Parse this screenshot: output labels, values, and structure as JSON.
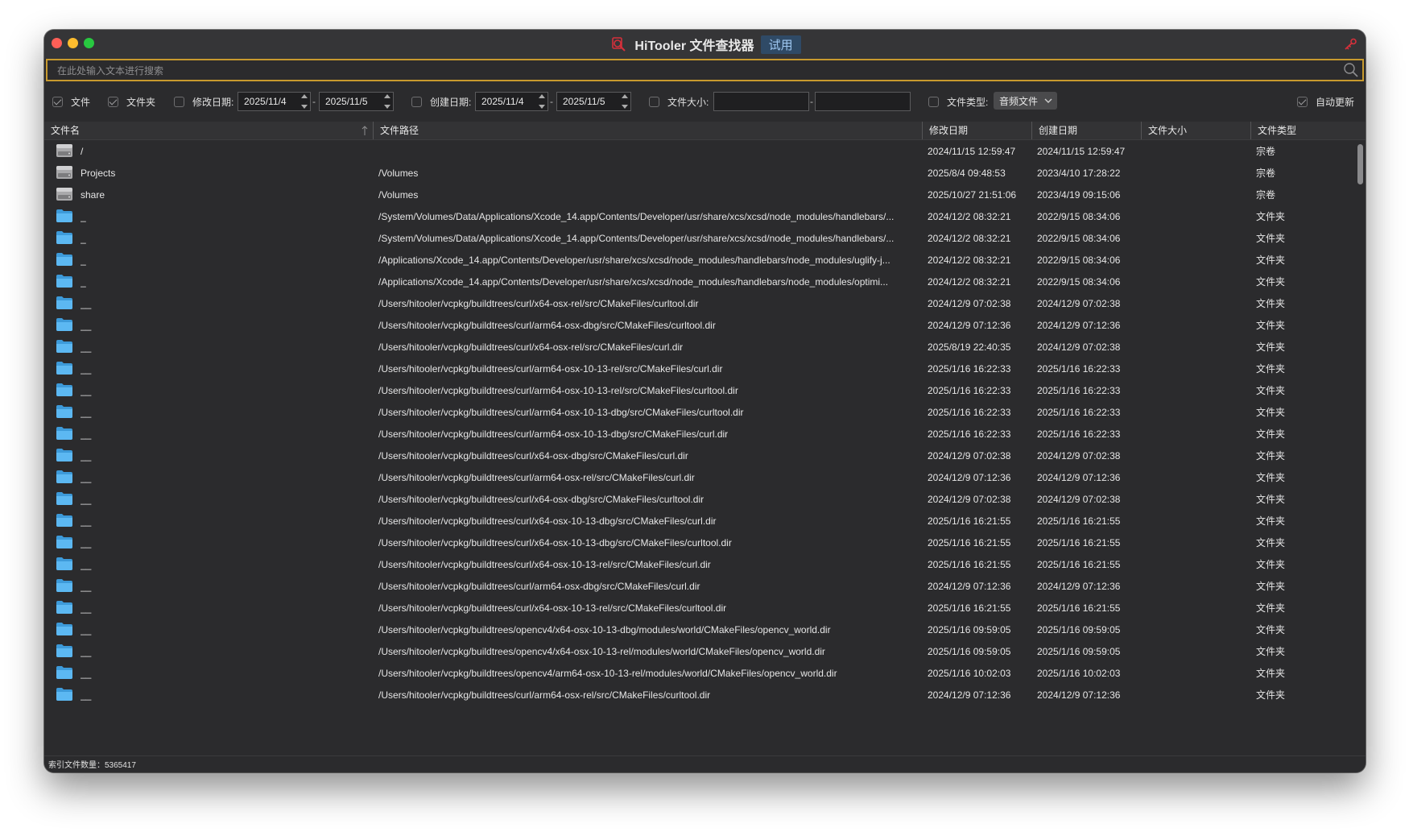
{
  "window": {
    "title": "HiTooler 文件查找器",
    "badge": "试用",
    "accent_color": "#c89a2e"
  },
  "search": {
    "placeholder": "在此处输入文本进行搜索",
    "value": ""
  },
  "filters": {
    "file": {
      "label": "文件",
      "checked": true
    },
    "folder": {
      "label": "文件夹",
      "checked": true
    },
    "modified": {
      "label": "修改日期:",
      "checked": false,
      "from": "2025/11/4",
      "to": "2025/11/5",
      "separator": "-"
    },
    "created": {
      "label": "创建日期:",
      "checked": false,
      "from": "2025/11/4",
      "to": "2025/11/5",
      "separator": "-"
    },
    "size": {
      "label": "文件大小:",
      "checked": false,
      "min": "",
      "max": "",
      "separator": "-"
    },
    "type": {
      "label": "文件类型:",
      "checked": false,
      "selected": "音频文件"
    },
    "auto_update": {
      "label": "自动更新",
      "checked": true
    }
  },
  "columns": {
    "name": "文件名",
    "path": "文件路径",
    "modified": "修改日期",
    "created": "创建日期",
    "size": "文件大小",
    "type": "文件类型"
  },
  "rows": [
    {
      "icon": "drive-icon",
      "name": "/",
      "path": "",
      "modified": "2024/11/15 12:59:47",
      "created": "2024/11/15 12:59:47",
      "size": "",
      "type": "宗卷"
    },
    {
      "icon": "drive-icon",
      "name": "Projects",
      "path": "/Volumes",
      "modified": "2025/8/4 09:48:53",
      "created": "2023/4/10 17:28:22",
      "size": "",
      "type": "宗卷"
    },
    {
      "icon": "drive-icon",
      "name": "share",
      "path": "/Volumes",
      "modified": "2025/10/27 21:51:06",
      "created": "2023/4/19 09:15:06",
      "size": "",
      "type": "宗卷"
    },
    {
      "icon": "folder-icon",
      "name": "_",
      "path": "/System/Volumes/Data/Applications/Xcode_14.app/Contents/Developer/usr/share/xcs/xcsd/node_modules/handlebars/...",
      "modified": "2024/12/2 08:32:21",
      "created": "2022/9/15 08:34:06",
      "size": "",
      "type": "文件夹"
    },
    {
      "icon": "folder-icon",
      "name": "_",
      "path": "/System/Volumes/Data/Applications/Xcode_14.app/Contents/Developer/usr/share/xcs/xcsd/node_modules/handlebars/...",
      "modified": "2024/12/2 08:32:21",
      "created": "2022/9/15 08:34:06",
      "size": "",
      "type": "文件夹"
    },
    {
      "icon": "folder-icon",
      "name": "_",
      "path": "/Applications/Xcode_14.app/Contents/Developer/usr/share/xcs/xcsd/node_modules/handlebars/node_modules/uglify-j...",
      "modified": "2024/12/2 08:32:21",
      "created": "2022/9/15 08:34:06",
      "size": "",
      "type": "文件夹"
    },
    {
      "icon": "folder-icon",
      "name": "_",
      "path": "/Applications/Xcode_14.app/Contents/Developer/usr/share/xcs/xcsd/node_modules/handlebars/node_modules/optimi...",
      "modified": "2024/12/2 08:32:21",
      "created": "2022/9/15 08:34:06",
      "size": "",
      "type": "文件夹"
    },
    {
      "icon": "folder-icon",
      "name": "__",
      "path": "/Users/hitooler/vcpkg/buildtrees/curl/x64-osx-rel/src/CMakeFiles/curltool.dir",
      "modified": "2024/12/9 07:02:38",
      "created": "2024/12/9 07:02:38",
      "size": "",
      "type": "文件夹"
    },
    {
      "icon": "folder-icon",
      "name": "__",
      "path": "/Users/hitooler/vcpkg/buildtrees/curl/arm64-osx-dbg/src/CMakeFiles/curltool.dir",
      "modified": "2024/12/9 07:12:36",
      "created": "2024/12/9 07:12:36",
      "size": "",
      "type": "文件夹"
    },
    {
      "icon": "folder-icon",
      "name": "__",
      "path": "/Users/hitooler/vcpkg/buildtrees/curl/x64-osx-rel/src/CMakeFiles/curl.dir",
      "modified": "2025/8/19 22:40:35",
      "created": "2024/12/9 07:02:38",
      "size": "",
      "type": "文件夹"
    },
    {
      "icon": "folder-icon",
      "name": "__",
      "path": "/Users/hitooler/vcpkg/buildtrees/curl/arm64-osx-10-13-rel/src/CMakeFiles/curl.dir",
      "modified": "2025/1/16 16:22:33",
      "created": "2025/1/16 16:22:33",
      "size": "",
      "type": "文件夹"
    },
    {
      "icon": "folder-icon",
      "name": "__",
      "path": "/Users/hitooler/vcpkg/buildtrees/curl/arm64-osx-10-13-rel/src/CMakeFiles/curltool.dir",
      "modified": "2025/1/16 16:22:33",
      "created": "2025/1/16 16:22:33",
      "size": "",
      "type": "文件夹"
    },
    {
      "icon": "folder-icon",
      "name": "__",
      "path": "/Users/hitooler/vcpkg/buildtrees/curl/arm64-osx-10-13-dbg/src/CMakeFiles/curltool.dir",
      "modified": "2025/1/16 16:22:33",
      "created": "2025/1/16 16:22:33",
      "size": "",
      "type": "文件夹"
    },
    {
      "icon": "folder-icon",
      "name": "__",
      "path": "/Users/hitooler/vcpkg/buildtrees/curl/arm64-osx-10-13-dbg/src/CMakeFiles/curl.dir",
      "modified": "2025/1/16 16:22:33",
      "created": "2025/1/16 16:22:33",
      "size": "",
      "type": "文件夹"
    },
    {
      "icon": "folder-icon",
      "name": "__",
      "path": "/Users/hitooler/vcpkg/buildtrees/curl/x64-osx-dbg/src/CMakeFiles/curl.dir",
      "modified": "2024/12/9 07:02:38",
      "created": "2024/12/9 07:02:38",
      "size": "",
      "type": "文件夹"
    },
    {
      "icon": "folder-icon",
      "name": "__",
      "path": "/Users/hitooler/vcpkg/buildtrees/curl/arm64-osx-rel/src/CMakeFiles/curl.dir",
      "modified": "2024/12/9 07:12:36",
      "created": "2024/12/9 07:12:36",
      "size": "",
      "type": "文件夹"
    },
    {
      "icon": "folder-icon",
      "name": "__",
      "path": "/Users/hitooler/vcpkg/buildtrees/curl/x64-osx-dbg/src/CMakeFiles/curltool.dir",
      "modified": "2024/12/9 07:02:38",
      "created": "2024/12/9 07:02:38",
      "size": "",
      "type": "文件夹"
    },
    {
      "icon": "folder-icon",
      "name": "__",
      "path": "/Users/hitooler/vcpkg/buildtrees/curl/x64-osx-10-13-dbg/src/CMakeFiles/curl.dir",
      "modified": "2025/1/16 16:21:55",
      "created": "2025/1/16 16:21:55",
      "size": "",
      "type": "文件夹"
    },
    {
      "icon": "folder-icon",
      "name": "__",
      "path": "/Users/hitooler/vcpkg/buildtrees/curl/x64-osx-10-13-dbg/src/CMakeFiles/curltool.dir",
      "modified": "2025/1/16 16:21:55",
      "created": "2025/1/16 16:21:55",
      "size": "",
      "type": "文件夹"
    },
    {
      "icon": "folder-icon",
      "name": "__",
      "path": "/Users/hitooler/vcpkg/buildtrees/curl/x64-osx-10-13-rel/src/CMakeFiles/curl.dir",
      "modified": "2025/1/16 16:21:55",
      "created": "2025/1/16 16:21:55",
      "size": "",
      "type": "文件夹"
    },
    {
      "icon": "folder-icon",
      "name": "__",
      "path": "/Users/hitooler/vcpkg/buildtrees/curl/arm64-osx-dbg/src/CMakeFiles/curl.dir",
      "modified": "2024/12/9 07:12:36",
      "created": "2024/12/9 07:12:36",
      "size": "",
      "type": "文件夹"
    },
    {
      "icon": "folder-icon",
      "name": "__",
      "path": "/Users/hitooler/vcpkg/buildtrees/curl/x64-osx-10-13-rel/src/CMakeFiles/curltool.dir",
      "modified": "2025/1/16 16:21:55",
      "created": "2025/1/16 16:21:55",
      "size": "",
      "type": "文件夹"
    },
    {
      "icon": "folder-icon",
      "name": "__",
      "path": "/Users/hitooler/vcpkg/buildtrees/opencv4/x64-osx-10-13-dbg/modules/world/CMakeFiles/opencv_world.dir",
      "modified": "2025/1/16 09:59:05",
      "created": "2025/1/16 09:59:05",
      "size": "",
      "type": "文件夹"
    },
    {
      "icon": "folder-icon",
      "name": "__",
      "path": "/Users/hitooler/vcpkg/buildtrees/opencv4/x64-osx-10-13-rel/modules/world/CMakeFiles/opencv_world.dir",
      "modified": "2025/1/16 09:59:05",
      "created": "2025/1/16 09:59:05",
      "size": "",
      "type": "文件夹"
    },
    {
      "icon": "folder-icon",
      "name": "__",
      "path": "/Users/hitooler/vcpkg/buildtrees/opencv4/arm64-osx-10-13-rel/modules/world/CMakeFiles/opencv_world.dir",
      "modified": "2025/1/16 10:02:03",
      "created": "2025/1/16 10:02:03",
      "size": "",
      "type": "文件夹"
    },
    {
      "icon": "folder-icon",
      "name": "__",
      "path": "/Users/hitooler/vcpkg/buildtrees/curl/arm64-osx-rel/src/CMakeFiles/curltool.dir",
      "modified": "2024/12/9 07:12:36",
      "created": "2024/12/9 07:12:36",
      "size": "",
      "type": "文件夹"
    }
  ],
  "status": {
    "text": "索引文件数量：5365417"
  }
}
